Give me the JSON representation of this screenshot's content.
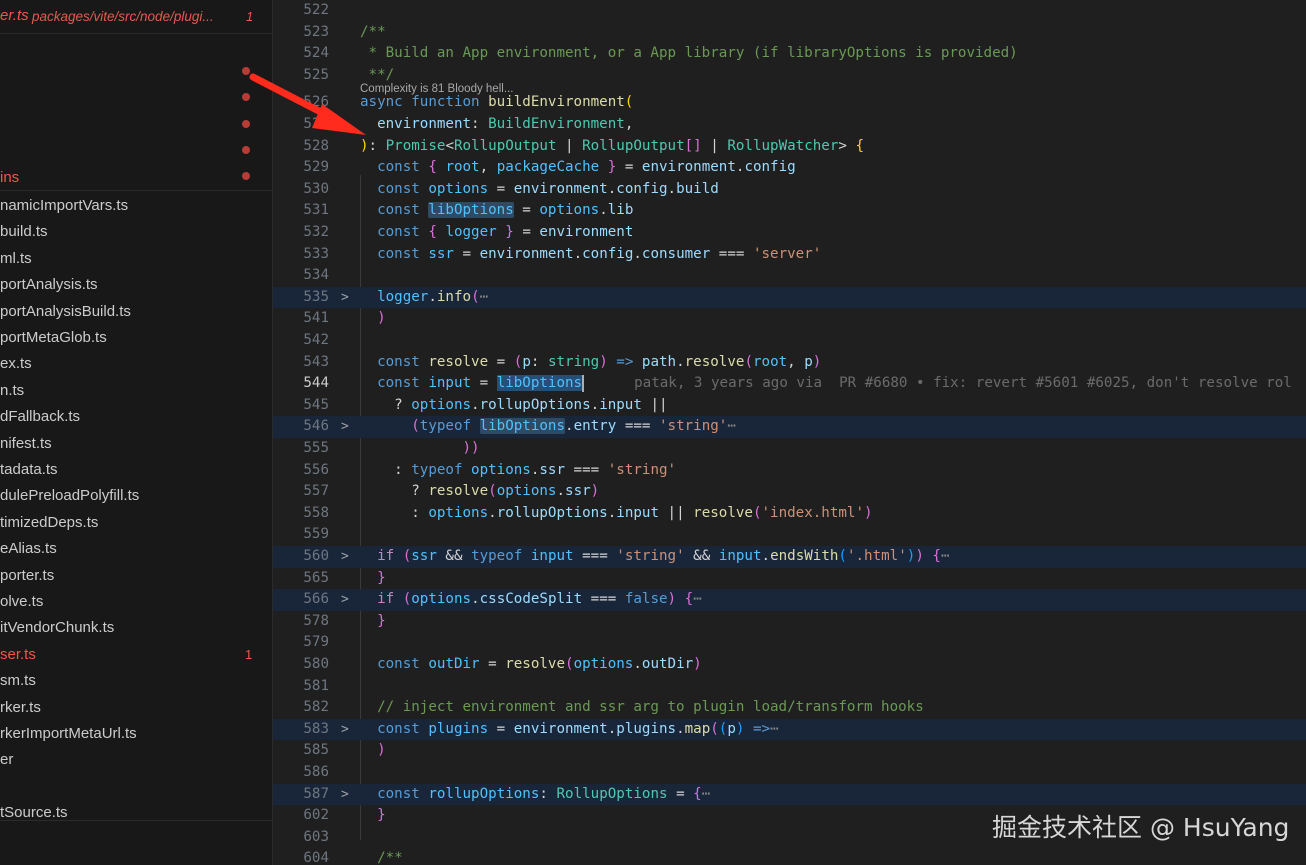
{
  "sidebar": {
    "open_editor": {
      "name": "er.ts",
      "path": "packages/vite/src/node/plugi...",
      "problems": "1"
    },
    "dirty_folder": "ins",
    "files": [
      "namicImportVars.ts",
      "build.ts",
      "ml.ts",
      "portAnalysis.ts",
      "portAnalysisBuild.ts",
      "portMetaGlob.ts",
      "ex.ts",
      "n.ts",
      "dFallback.ts",
      "nifest.ts",
      "tadata.ts",
      "dulePreloadPolyfill.ts",
      "timizedDeps.ts",
      "eAlias.ts",
      "porter.ts",
      "olve.ts",
      "itVendorChunk.ts",
      "ser.ts",
      "sm.ts",
      "rker.ts",
      "rkerImportMetaUrl.ts",
      "er",
      "",
      "tSource.ts"
    ],
    "error_file_badge": "1"
  },
  "editor": {
    "code_lens": "Complexity is 81 Bloody hell...",
    "blame": "patak, 3 years ago via  PR #6680 • fix: revert #5601 #6025, don't resolve rol",
    "lines": [
      {
        "n": "522"
      },
      {
        "n": "523",
        "t": [
          [
            "/**",
            "com"
          ]
        ]
      },
      {
        "n": "524",
        "t": [
          [
            " * Build an App environment, or a App library (if libraryOptions is provided)",
            "com"
          ]
        ]
      },
      {
        "n": "525",
        "t": [
          [
            " **/",
            "com"
          ]
        ]
      },
      {
        "n": "526",
        "t": [
          [
            "async ",
            "kw"
          ],
          [
            "function ",
            "kw"
          ],
          [
            "buildEnvironment",
            "fn"
          ],
          [
            "(",
            "b1"
          ]
        ]
      },
      {
        "n": "527",
        "t": [
          [
            "  environment",
            "var"
          ],
          [
            ": ",
            "op"
          ],
          [
            "BuildEnvironment",
            "type"
          ],
          [
            ",",
            "op"
          ]
        ]
      },
      {
        "n": "528",
        "t": [
          [
            ")",
            "b1"
          ],
          [
            ": ",
            "op"
          ],
          [
            "Promise",
            "type"
          ],
          [
            "<",
            "op"
          ],
          [
            "RollupOutput",
            "type"
          ],
          [
            " | ",
            "op"
          ],
          [
            "RollupOutput",
            "type"
          ],
          [
            "[]",
            "b2"
          ],
          [
            " | ",
            "op"
          ],
          [
            "RollupWatcher",
            "type"
          ],
          [
            "> ",
            "op"
          ],
          [
            "{",
            "b1"
          ]
        ]
      },
      {
        "n": "529",
        "t": [
          [
            "  const ",
            "kw"
          ],
          [
            "{ ",
            "b2"
          ],
          [
            "root",
            "const"
          ],
          [
            ", ",
            "op"
          ],
          [
            "packageCache",
            "const"
          ],
          [
            " }",
            "b2"
          ],
          [
            " = ",
            "op"
          ],
          [
            "environment",
            "var"
          ],
          [
            ".",
            "op"
          ],
          [
            "config",
            "var"
          ]
        ]
      },
      {
        "n": "530",
        "t": [
          [
            "  const ",
            "kw"
          ],
          [
            "options",
            "const"
          ],
          [
            " = ",
            "op"
          ],
          [
            "environment",
            "var"
          ],
          [
            ".",
            "op"
          ],
          [
            "config",
            "var"
          ],
          [
            ".",
            "op"
          ],
          [
            "build",
            "var"
          ]
        ]
      },
      {
        "n": "531",
        "t": [
          [
            "  const ",
            "kw"
          ],
          [
            "libOptions",
            "const",
            "word"
          ],
          [
            " = ",
            "op"
          ],
          [
            "options",
            "const"
          ],
          [
            ".",
            "op"
          ],
          [
            "lib",
            "var"
          ]
        ]
      },
      {
        "n": "532",
        "t": [
          [
            "  const ",
            "kw"
          ],
          [
            "{ ",
            "b2"
          ],
          [
            "logger",
            "const"
          ],
          [
            " }",
            "b2"
          ],
          [
            " = ",
            "op"
          ],
          [
            "environment",
            "var"
          ]
        ]
      },
      {
        "n": "533",
        "t": [
          [
            "  const ",
            "kw"
          ],
          [
            "ssr",
            "const"
          ],
          [
            " = ",
            "op"
          ],
          [
            "environment",
            "var"
          ],
          [
            ".",
            "op"
          ],
          [
            "config",
            "var"
          ],
          [
            ".",
            "op"
          ],
          [
            "consumer",
            "var"
          ],
          [
            " === ",
            "op"
          ],
          [
            "'server'",
            "str"
          ]
        ]
      },
      {
        "n": "534"
      },
      {
        "n": "535",
        "f": ">",
        "h": true,
        "t": [
          [
            "  logger",
            "const"
          ],
          [
            ".",
            "op"
          ],
          [
            "info",
            "fn"
          ],
          [
            "(",
            "b2"
          ],
          [
            "⋯",
            "ell"
          ]
        ]
      },
      {
        "n": "541",
        "t": [
          [
            "  ",
            "op"
          ],
          [
            ")",
            "b2"
          ]
        ]
      },
      {
        "n": "542"
      },
      {
        "n": "543",
        "t": [
          [
            "  const ",
            "kw"
          ],
          [
            "resolve",
            "fn"
          ],
          [
            " = ",
            "op"
          ],
          [
            "(",
            "b2"
          ],
          [
            "p",
            "var"
          ],
          [
            ": ",
            "op"
          ],
          [
            "string",
            "type"
          ],
          [
            ")",
            "b2"
          ],
          [
            " => ",
            "kw"
          ],
          [
            "path",
            "var"
          ],
          [
            ".",
            "op"
          ],
          [
            "resolve",
            "fn"
          ],
          [
            "(",
            "b2"
          ],
          [
            "root",
            "const"
          ],
          [
            ", ",
            "op"
          ],
          [
            "p",
            "var"
          ],
          [
            ")",
            "b2"
          ]
        ]
      },
      {
        "n": "544",
        "cur": true,
        "t": [
          [
            "  const ",
            "kw"
          ],
          [
            "input",
            "const"
          ],
          [
            " = ",
            "op"
          ],
          [
            "libOptions",
            "const",
            "sel"
          ]
        ]
      },
      {
        "n": "545",
        "t": [
          [
            "    ? ",
            "op"
          ],
          [
            "options",
            "const"
          ],
          [
            ".",
            "op"
          ],
          [
            "rollupOptions",
            "var"
          ],
          [
            ".",
            "op"
          ],
          [
            "input",
            "var"
          ],
          [
            " ||",
            "op"
          ]
        ]
      },
      {
        "n": "546",
        "f": ">",
        "h": true,
        "t": [
          [
            "      ",
            "op"
          ],
          [
            "(",
            "b2"
          ],
          [
            "typeof ",
            "kw"
          ],
          [
            "libOptions",
            "const",
            "word"
          ],
          [
            ".",
            "op"
          ],
          [
            "entry",
            "var"
          ],
          [
            " === ",
            "op"
          ],
          [
            "'string'",
            "str"
          ],
          [
            "⋯",
            "ell"
          ]
        ]
      },
      {
        "n": "555",
        "t": [
          [
            "            ",
            "op"
          ],
          [
            "))",
            "b2"
          ]
        ]
      },
      {
        "n": "556",
        "t": [
          [
            "    : ",
            "op"
          ],
          [
            "typeof ",
            "kw"
          ],
          [
            "options",
            "const"
          ],
          [
            ".",
            "op"
          ],
          [
            "ssr",
            "var"
          ],
          [
            " === ",
            "op"
          ],
          [
            "'string'",
            "str"
          ]
        ]
      },
      {
        "n": "557",
        "t": [
          [
            "      ? ",
            "op"
          ],
          [
            "resolve",
            "fn"
          ],
          [
            "(",
            "b2"
          ],
          [
            "options",
            "const"
          ],
          [
            ".",
            "op"
          ],
          [
            "ssr",
            "var"
          ],
          [
            ")",
            "b2"
          ]
        ]
      },
      {
        "n": "558",
        "t": [
          [
            "      : ",
            "op"
          ],
          [
            "options",
            "const"
          ],
          [
            ".",
            "op"
          ],
          [
            "rollupOptions",
            "var"
          ],
          [
            ".",
            "op"
          ],
          [
            "input",
            "var"
          ],
          [
            " || ",
            "op"
          ],
          [
            "resolve",
            "fn"
          ],
          [
            "(",
            "b2"
          ],
          [
            "'index.html'",
            "str"
          ],
          [
            ")",
            "b2"
          ]
        ]
      },
      {
        "n": "559"
      },
      {
        "n": "560",
        "f": ">",
        "h": true,
        "t": [
          [
            "  if ",
            "cf"
          ],
          [
            "(",
            "b2"
          ],
          [
            "ssr",
            "const"
          ],
          [
            " && ",
            "op"
          ],
          [
            "typeof ",
            "kw"
          ],
          [
            "input",
            "const"
          ],
          [
            " === ",
            "op"
          ],
          [
            "'string'",
            "str"
          ],
          [
            " && ",
            "op"
          ],
          [
            "input",
            "const"
          ],
          [
            ".",
            "op"
          ],
          [
            "endsWith",
            "fn"
          ],
          [
            "(",
            "b3"
          ],
          [
            "'.html'",
            "str"
          ],
          [
            ")",
            "b3"
          ],
          [
            ")",
            "b2"
          ],
          [
            " {",
            "b2"
          ],
          [
            "⋯",
            "ell"
          ]
        ]
      },
      {
        "n": "565",
        "t": [
          [
            "  ",
            "op"
          ],
          [
            "}",
            "b2"
          ]
        ]
      },
      {
        "n": "566",
        "f": ">",
        "h": true,
        "t": [
          [
            "  if ",
            "cf"
          ],
          [
            "(",
            "b2"
          ],
          [
            "options",
            "const"
          ],
          [
            ".",
            "op"
          ],
          [
            "cssCodeSplit",
            "var"
          ],
          [
            " === ",
            "op"
          ],
          [
            "false",
            "kw"
          ],
          [
            ")",
            "b2"
          ],
          [
            " {",
            "b2"
          ],
          [
            "⋯",
            "ell"
          ]
        ]
      },
      {
        "n": "578",
        "t": [
          [
            "  ",
            "op"
          ],
          [
            "}",
            "b2"
          ]
        ]
      },
      {
        "n": "579"
      },
      {
        "n": "580",
        "t": [
          [
            "  const ",
            "kw"
          ],
          [
            "outDir",
            "const"
          ],
          [
            " = ",
            "op"
          ],
          [
            "resolve",
            "fn"
          ],
          [
            "(",
            "b2"
          ],
          [
            "options",
            "const"
          ],
          [
            ".",
            "op"
          ],
          [
            "outDir",
            "var"
          ],
          [
            ")",
            "b2"
          ]
        ]
      },
      {
        "n": "581"
      },
      {
        "n": "582",
        "t": [
          [
            "  // inject environment and ssr arg to plugin load/transform hooks",
            "com"
          ]
        ]
      },
      {
        "n": "583",
        "f": ">",
        "h": true,
        "t": [
          [
            "  const ",
            "kw"
          ],
          [
            "plugins",
            "const"
          ],
          [
            " = ",
            "op"
          ],
          [
            "environment",
            "var"
          ],
          [
            ".",
            "op"
          ],
          [
            "plugins",
            "var"
          ],
          [
            ".",
            "op"
          ],
          [
            "map",
            "fn"
          ],
          [
            "(",
            "b2"
          ],
          [
            "(",
            "b3"
          ],
          [
            "p",
            "var"
          ],
          [
            ")",
            "b3"
          ],
          [
            " =>",
            "kw"
          ],
          [
            "⋯",
            "ell"
          ]
        ]
      },
      {
        "n": "585",
        "t": [
          [
            "  ",
            "op"
          ],
          [
            ")",
            "b2"
          ]
        ]
      },
      {
        "n": "586"
      },
      {
        "n": "587",
        "f": ">",
        "h": true,
        "t": [
          [
            "  const ",
            "kw"
          ],
          [
            "rollupOptions",
            "const"
          ],
          [
            ": ",
            "op"
          ],
          [
            "RollupOptions",
            "type"
          ],
          [
            " = ",
            "op"
          ],
          [
            "{",
            "b2"
          ],
          [
            "⋯",
            "ell"
          ]
        ]
      },
      {
        "n": "602",
        "t": [
          [
            "  ",
            "op"
          ],
          [
            "}",
            "b2"
          ]
        ]
      },
      {
        "n": "603"
      },
      {
        "n": "604",
        "t": [
          [
            "  /**",
            "com"
          ]
        ]
      }
    ]
  },
  "watermark": "掘金技术社区 @ HsuYang",
  "colors": {
    "error": "#f2564b",
    "arrow": "#ff2b1c",
    "highlight_row": "#19263a"
  }
}
